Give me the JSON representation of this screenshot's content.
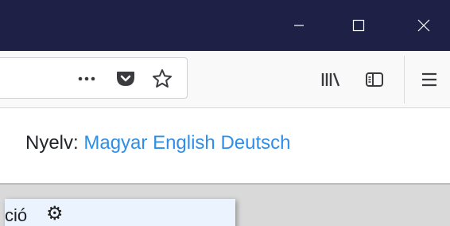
{
  "window_controls": {
    "minimize_icon": "minimize-icon",
    "maximize_icon": "maximize-icon",
    "close_icon": "close-icon"
  },
  "toolbar": {
    "page_actions_icon": "ellipsis-icon",
    "pocket_icon": "pocket-icon",
    "bookmark_icon": "star-icon",
    "library_icon": "library-icon",
    "sidebar_icon": "sidebar-icon",
    "menu_icon": "hamburger-menu-icon"
  },
  "language": {
    "label": "Nyelv:",
    "options": [
      "Magyar",
      "English",
      "Deutsch"
    ]
  },
  "card": {
    "text": "ció",
    "icon": "gear-icon"
  },
  "colors": {
    "titlebar": "#1e2145",
    "link": "#2f8fe8",
    "card_bg": "#eaf3fe"
  }
}
